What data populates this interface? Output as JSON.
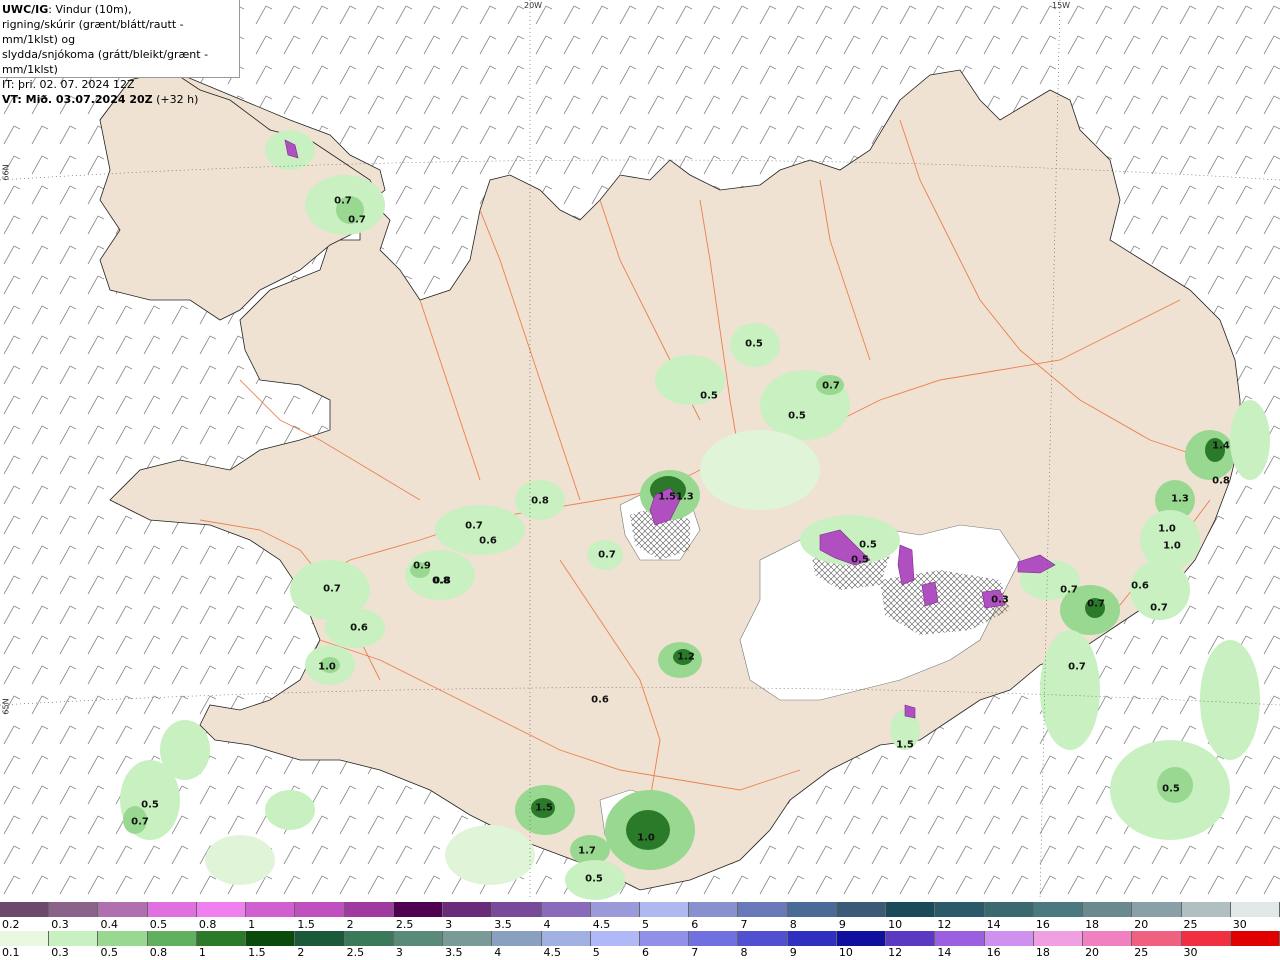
{
  "title": {
    "line1_bold": "UWC/IG",
    "line1_rest": ": Vindur (10m),",
    "line2": "rigning/skúrir (grænt/blátt/rautt - mm/1klst) og",
    "line3": "slydda/snjókoma (grátt/bleikt/grænt - mm/1klst)",
    "line4": "IT: þri. 02. 07. 2024 12Z",
    "line5_bold": "VT: Mið. 03.07.2024 20Z",
    "line5_rest": " (+32 h)"
  },
  "grid_labels": {
    "lon": [
      "20W",
      "15W"
    ],
    "lat": [
      "66N",
      "65N"
    ]
  },
  "precip_labels": [
    "0.7",
    "0.7",
    "0.5",
    "0.5",
    "0.7",
    "0.5",
    "0.8",
    "0.7",
    "0.6",
    "1.51.3",
    "0.7",
    "0.8",
    "0.6",
    "0.5",
    "0.9",
    "0.8",
    "0.7",
    "0.6",
    "1.0",
    "1.2",
    "0.5",
    "0.7",
    "1.4",
    "0.8",
    "1.3",
    "1.0",
    "1.0",
    "0.6",
    "0.7",
    "0.7",
    "0.3",
    "0.7",
    "1.5",
    "1.5",
    "1.0",
    "1.7",
    "0.5",
    "0.5",
    "0.5",
    "0.7"
  ],
  "legend_top": {
    "labels": [
      "0.2",
      "0.3",
      "0.4",
      "0.5",
      "0.8",
      "1",
      "1.5",
      "2",
      "2.5",
      "3",
      "3.5",
      "4",
      "4.5",
      "5",
      "6",
      "7",
      "8",
      "9",
      "10",
      "12",
      "14",
      "16",
      "18",
      "20",
      "25",
      "30"
    ],
    "colors": [
      "#6b4a6b",
      "#8a628a",
      "#b070b0",
      "#e070e0",
      "#f080f0",
      "#d060d0",
      "#c050c0",
      "#a03aa0",
      "#500050",
      "#6a2a7a",
      "#7a4a9a",
      "#8a6aba",
      "#9a9ada",
      "#b0b8f0",
      "#8890d0",
      "#6878b8",
      "#4a6a98",
      "#3a5a78",
      "#1a4a5a",
      "#2a5a6a",
      "#3a6a70",
      "#4a7a80",
      "#6a8a90",
      "#8aa0a8",
      "#b0c0c0",
      "#e0e8e8"
    ]
  },
  "legend_bottom": {
    "labels": [
      "0.1",
      "0.3",
      "0.5",
      "0.8",
      "1",
      "1.5",
      "2",
      "2.5",
      "3",
      "3.5",
      "4",
      "4.5",
      "5",
      "6",
      "7",
      "8",
      "9",
      "10",
      "12",
      "14",
      "16",
      "18",
      "20",
      "25",
      "30"
    ],
    "colors": [
      "#e8f8e0",
      "#c8f0c0",
      "#98d890",
      "#60b060",
      "#2a7a2a",
      "#0a4a0a",
      "#1a5a3a",
      "#3a7a5a",
      "#5a8a7a",
      "#7a9a98",
      "#8aa0c0",
      "#a0b0e0",
      "#b0b8f8",
      "#9090e8",
      "#7070e0",
      "#5050d0",
      "#3030c0",
      "#1010a0",
      "#5a3ac0",
      "#9a60e0",
      "#d090f0",
      "#f0a0e0",
      "#f080c0",
      "#f06080",
      "#f03040",
      "#e00000"
    ]
  },
  "colors": {
    "land": "#efe2d2",
    "sea": "#ffffff",
    "roads": "#e8703a",
    "precip_light": "#c8f0c0",
    "precip_mid": "#98d890",
    "precip_dark": "#2a7a2a",
    "snow": "#b050c0"
  }
}
